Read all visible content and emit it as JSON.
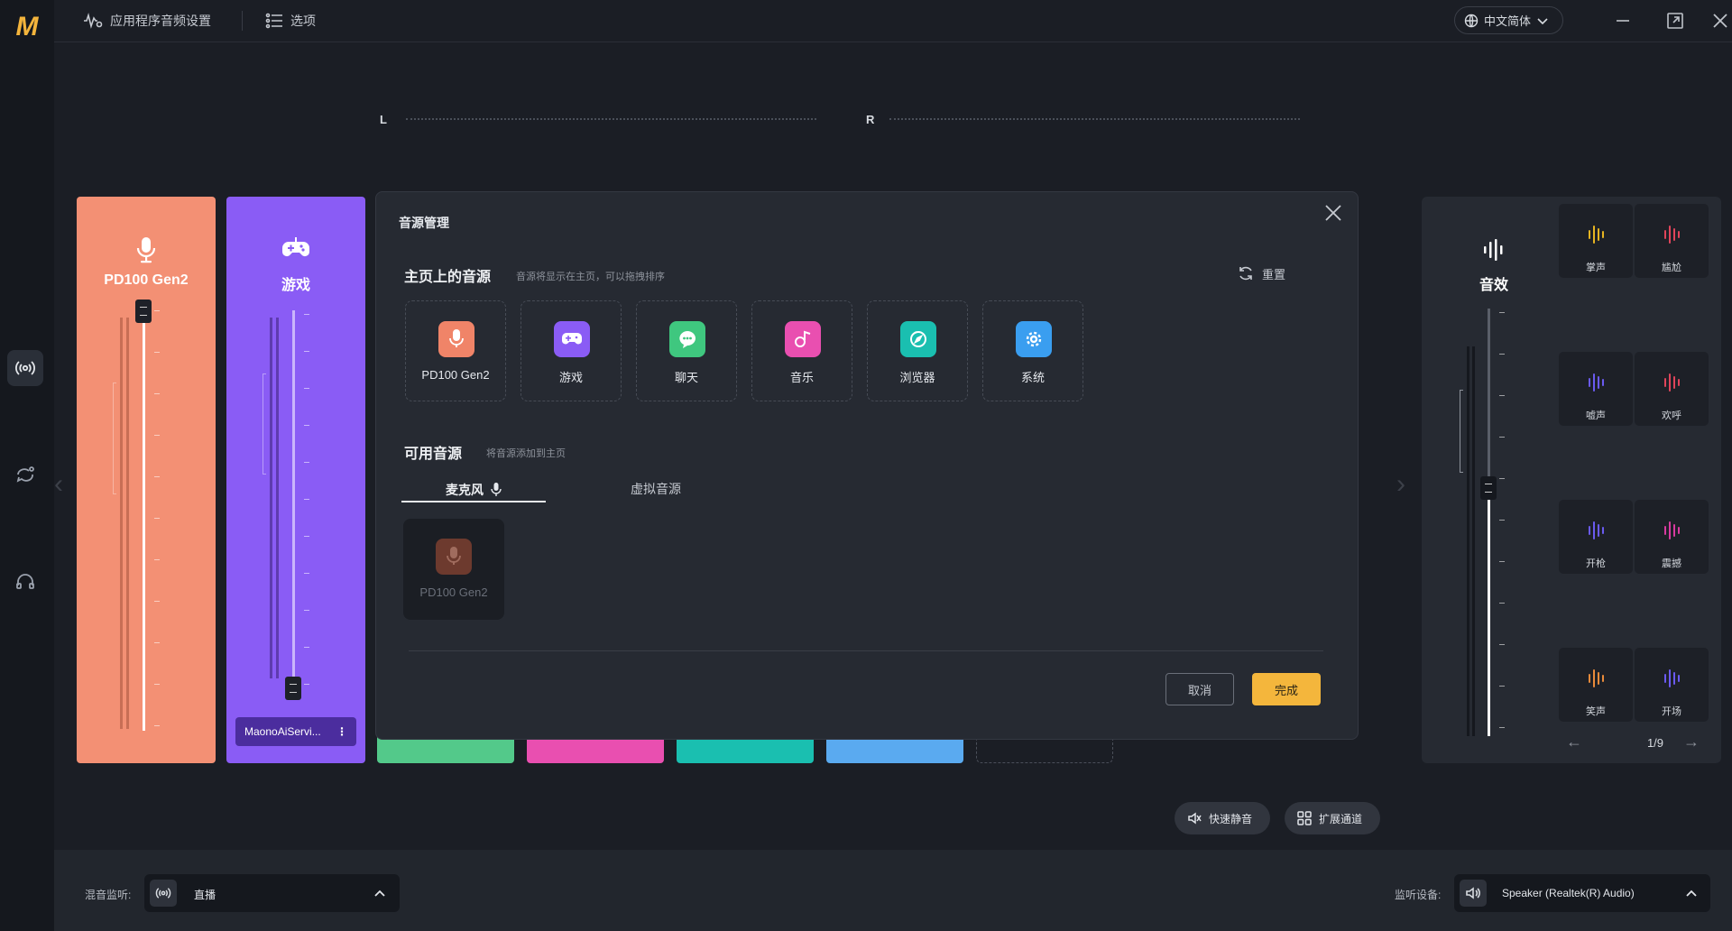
{
  "header": {
    "audio_settings_label": "应用程序音频设置",
    "options_label": "选项",
    "language": "中文简体"
  },
  "meter": {
    "left_label": "L",
    "right_label": "R"
  },
  "strips": [
    {
      "name": "PD100 Gen2",
      "color": "#f39074",
      "icon": "microphone-icon"
    },
    {
      "name": "游戏",
      "color": "#8a5cf5",
      "icon": "gamepad-icon",
      "device": "MaonoAiServi..."
    }
  ],
  "strip_colors_behind": [
    "#53c98a",
    "#e94fb0",
    "#1abfb0",
    "#5aaaf0"
  ],
  "modal": {
    "title": "音源管理",
    "home_section_title": "主页上的音源",
    "home_section_hint": "音源将显示在主页，可以拖拽排序",
    "reset_label": "重置",
    "home_sources": [
      {
        "label": "PD100 Gen2",
        "color": "#f08468",
        "icon": "microphone-icon"
      },
      {
        "label": "游戏",
        "color": "#8a5cf5",
        "icon": "gamepad-icon"
      },
      {
        "label": "聊天",
        "color": "#3fc77f",
        "icon": "chat-icon"
      },
      {
        "label": "音乐",
        "color": "#e94fb0",
        "icon": "music-icon"
      },
      {
        "label": "浏览器",
        "color": "#1abfb0",
        "icon": "browser-icon"
      },
      {
        "label": "系统",
        "color": "#3a9ef0",
        "icon": "gear-icon"
      }
    ],
    "available_section_title": "可用音源",
    "available_section_hint": "将音源添加到主页",
    "tabs": [
      {
        "label": "麦克风"
      },
      {
        "label": "虚拟音源"
      }
    ],
    "available_sources": [
      {
        "label": "PD100 Gen2",
        "icon": "microphone-icon"
      }
    ],
    "cancel_label": "取消",
    "done_label": "完成"
  },
  "sfx": {
    "title": "音效",
    "items": [
      {
        "name": "掌声",
        "color": "#e6b422"
      },
      {
        "name": "尴尬",
        "color": "#e0445a"
      },
      {
        "name": "嘘声",
        "color": "#6a5af0"
      },
      {
        "name": "欢呼",
        "color": "#e0445a"
      },
      {
        "name": "开枪",
        "color": "#6a5af0"
      },
      {
        "name": "震撼",
        "color": "#d93aa0"
      },
      {
        "name": "笑声",
        "color": "#e98a3a"
      },
      {
        "name": "开场",
        "color": "#6a5af0"
      }
    ],
    "page": "1/9"
  },
  "actions": {
    "quick_mute": "快速静音",
    "expand_channel": "扩展通道"
  },
  "bottom": {
    "mix_monitor_label": "混音监听:",
    "mix_monitor_value": "直播",
    "monitor_device_label": "监听设备:",
    "monitor_device_value": "Speaker (Realtek(R) Audio)"
  }
}
